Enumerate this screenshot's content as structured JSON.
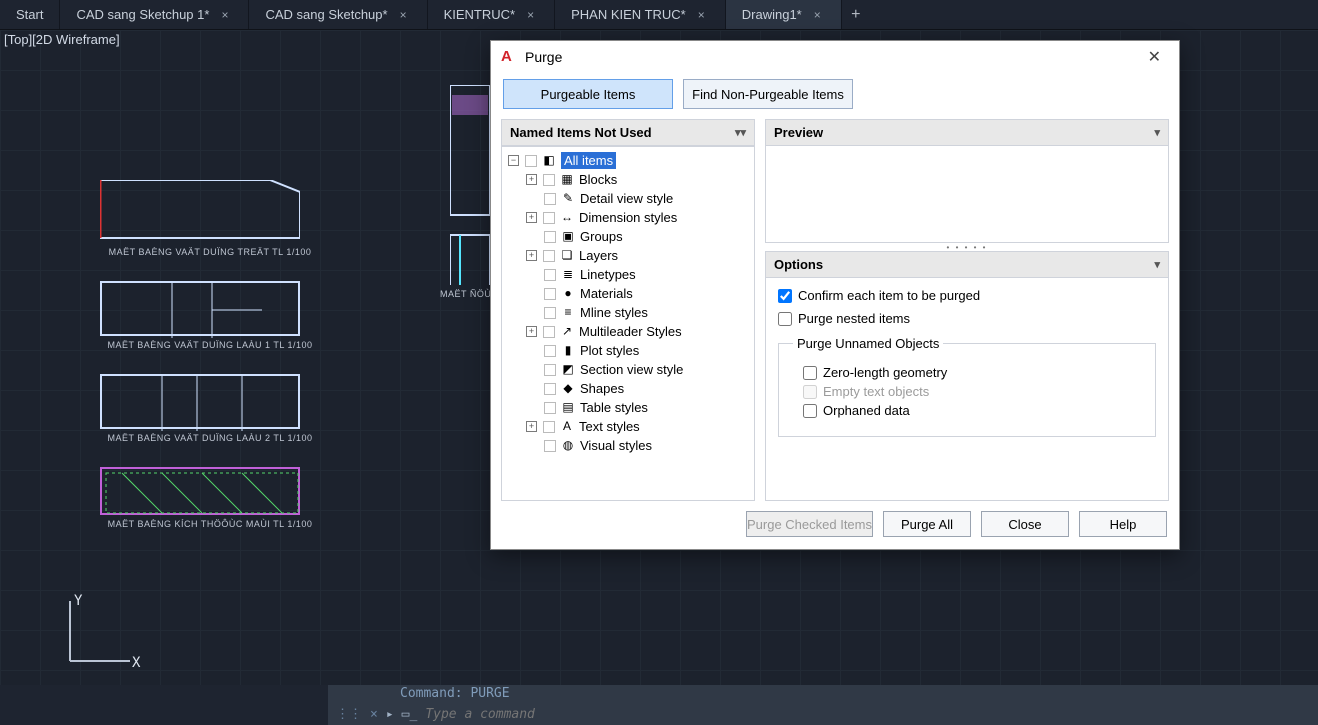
{
  "tabs": [
    {
      "label": "Start",
      "closable": false,
      "active": false
    },
    {
      "label": "CAD sang Sketchup 1*",
      "closable": true,
      "active": false
    },
    {
      "label": "CAD sang Sketchup*",
      "closable": true,
      "active": false
    },
    {
      "label": "KIENTRUC*",
      "closable": true,
      "active": false
    },
    {
      "label": "PHAN KIEN TRUC*",
      "closable": true,
      "active": false
    },
    {
      "label": "Drawing1*",
      "closable": true,
      "active": true
    }
  ],
  "viewport_label": "[Top][2D Wireframe]",
  "drawing_labels": {
    "l1": "MAËT BAÈNG VAÄT DUÏNG TREÄT TL 1/100",
    "l2": "MAËT BAÈNG VAÄT DUÏNG LAÀU 1 TL 1/100",
    "l3": "MAËT BAÈNG VAÄT DUÏNG LAÀU 2 TL 1/100",
    "l4": "MAËT BAÈNG KÍCH THÖÔÙC MAÙI TL 1/100",
    "side": "MAËT ÑÖÙ"
  },
  "ucs": {
    "y": "Y",
    "x": "X"
  },
  "dialog": {
    "title": "Purge",
    "tab_purgeable": "Purgeable Items",
    "tab_nonpurgeable": "Find Non-Purgeable Items",
    "left_header": "Named Items Not Used",
    "preview_header": "Preview",
    "options_header": "Options",
    "tree": [
      {
        "label": "All items",
        "expandable": true,
        "expanded": true,
        "selected": true,
        "icon": "◧",
        "level": 0
      },
      {
        "label": "Blocks",
        "expandable": true,
        "expanded": false,
        "icon": "▦",
        "level": 1
      },
      {
        "label": "Detail view style",
        "expandable": false,
        "icon": "✎",
        "level": 1
      },
      {
        "label": "Dimension styles",
        "expandable": true,
        "expanded": false,
        "icon": "↔",
        "level": 1
      },
      {
        "label": "Groups",
        "expandable": false,
        "icon": "▣",
        "level": 1
      },
      {
        "label": "Layers",
        "expandable": true,
        "expanded": false,
        "icon": "❏",
        "level": 1
      },
      {
        "label": "Linetypes",
        "expandable": false,
        "icon": "≣",
        "level": 1
      },
      {
        "label": "Materials",
        "expandable": false,
        "icon": "●",
        "level": 1
      },
      {
        "label": "Mline styles",
        "expandable": false,
        "icon": "≡",
        "level": 1
      },
      {
        "label": "Multileader Styles",
        "expandable": true,
        "expanded": false,
        "icon": "↗",
        "level": 1
      },
      {
        "label": "Plot styles",
        "expandable": false,
        "icon": "▮",
        "level": 1
      },
      {
        "label": "Section view style",
        "expandable": false,
        "icon": "◩",
        "level": 1
      },
      {
        "label": "Shapes",
        "expandable": false,
        "icon": "◆",
        "level": 1
      },
      {
        "label": "Table styles",
        "expandable": false,
        "icon": "▤",
        "level": 1
      },
      {
        "label": "Text styles",
        "expandable": true,
        "expanded": false,
        "icon": "A",
        "level": 1
      },
      {
        "label": "Visual styles",
        "expandable": false,
        "icon": "◍",
        "level": 1
      }
    ],
    "options": {
      "confirm": {
        "label": "Confirm each item to be purged",
        "checked": true,
        "enabled": true
      },
      "nested": {
        "label": "Purge nested items",
        "checked": false,
        "enabled": true
      },
      "group_label": "Purge Unnamed Objects",
      "zero_geom": {
        "label": "Zero-length geometry",
        "checked": false,
        "enabled": true
      },
      "empty_text": {
        "label": "Empty text objects",
        "checked": false,
        "enabled": false
      },
      "orphaned": {
        "label": "Orphaned data",
        "checked": false,
        "enabled": true
      }
    },
    "buttons": {
      "purge_checked": "Purge Checked Items",
      "purge_all": "Purge All",
      "close": "Close",
      "help": "Help"
    }
  },
  "command": {
    "history": "Command: PURGE",
    "placeholder": "Type a command",
    "chevron": "▸"
  }
}
